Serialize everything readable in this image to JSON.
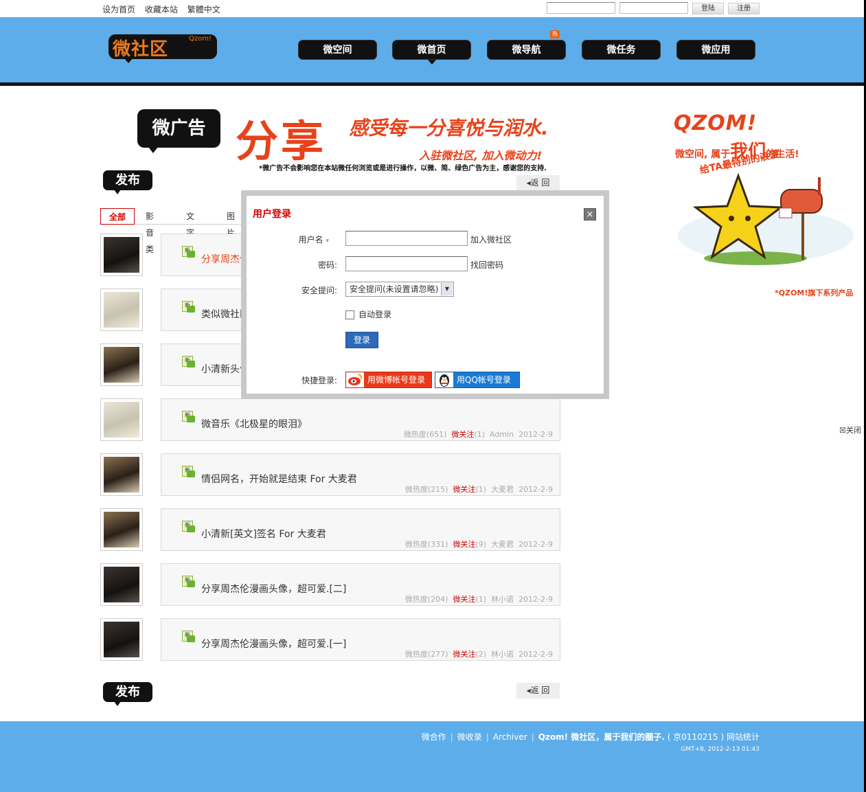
{
  "topbar": {
    "links": [
      "设为首页",
      "收藏本站",
      "繁體中文"
    ],
    "login_label": "登陆",
    "register_label": "注册"
  },
  "logo": {
    "cn": "微社区",
    "en": "Qzom!"
  },
  "nav": {
    "items": [
      "微空间",
      "微首页",
      "微导航",
      "微任务",
      "微应用"
    ],
    "active_index": 1,
    "hot_badge": "热"
  },
  "ad": {
    "badge": "微广告",
    "headline": "分享",
    "slogan1": "感受每一分喜悦与润水.",
    "slogan2": "入驻微社区, 加入微动力!",
    "note": "*微广告不会影响您在本站微任何浏览或是进行操作，以微、简、绿色广告为主，感谢您的支持."
  },
  "right_ad": {
    "title": "QZOM!",
    "sub_prefix": "微空间, 属于",
    "sub_emph": "我们",
    "sub_suffix": "的生活!",
    "sub2": "给TA最特别的浪漫",
    "note": "*QZOM!旗下系列产品",
    "close": "☒关闭"
  },
  "publish_label": "发布",
  "back_label": "返 回",
  "tabs": [
    "全部",
    "影音类",
    "文字类",
    "图片类"
  ],
  "items": [
    {
      "title": "分享周杰伦",
      "hot": true,
      "heat": "",
      "follow": "",
      "author": "",
      "date": ""
    },
    {
      "title": "类似微社区",
      "hot": false,
      "heat": "",
      "follow": "",
      "author": "",
      "date": ""
    },
    {
      "title": "小清新头像",
      "hot": false,
      "heat": "",
      "follow": "",
      "author": "",
      "date": ""
    },
    {
      "title": "微音乐《北极星的眼泪》",
      "hot": false,
      "heat": "微热度(651)",
      "follow": "微关注",
      "follow_count": "(1)",
      "author": "Admin",
      "date": "2012-2-9"
    },
    {
      "title": "情侣网名，开始就是结束 For 大麦君",
      "hot": false,
      "heat": "微热度(215)",
      "follow": "微关注",
      "follow_count": "(1)",
      "author": "大麦君",
      "date": "2012-2-9"
    },
    {
      "title": "小清新[英文]签名 For 大麦君",
      "hot": false,
      "heat": "微热度(331)",
      "follow": "微关注",
      "follow_count": "(9)",
      "author": "大麦君",
      "date": "2012-2-9"
    },
    {
      "title": "分享周杰伦漫画头像，超可爱.[二]",
      "hot": false,
      "heat": "微热度(204)",
      "follow": "微关注",
      "follow_count": "(1)",
      "author": "林小诺",
      "date": "2012-2-9"
    },
    {
      "title": "分享周杰伦漫画头像，超可爱.[一]",
      "hot": false,
      "heat": "微热度(277)",
      "follow": "微关注",
      "follow_count": "(2)",
      "author": "林小诺",
      "date": "2012-2-9"
    }
  ],
  "new_label": "新",
  "modal": {
    "title": "用户登录",
    "close": "×",
    "username_label": "用户名",
    "join_link": "加入微社区",
    "password_label": "密码:",
    "forgot_link": "找回密码",
    "question_label": "安全提问:",
    "question_value": "安全提问(未设置请忽略)",
    "auto_login": "自动登录",
    "login_button": "登录",
    "quick_label": "快捷登录:",
    "weibo_button": "用微博帐号登录",
    "qq_button": "用QQ帐号登录"
  },
  "footer": {
    "links": [
      "微合作",
      "微收录",
      "Archiver"
    ],
    "brand": "Qzom! 微社区，属于我们的圈子.",
    "icp": "( 京0110215 )",
    "stats": "网站统计",
    "time": "GMT+8, 2012-2-13 01:43"
  },
  "colors": {
    "header_blue": "#5dadea",
    "accent_red": "#d40000",
    "ad_orange": "#e8421a"
  }
}
